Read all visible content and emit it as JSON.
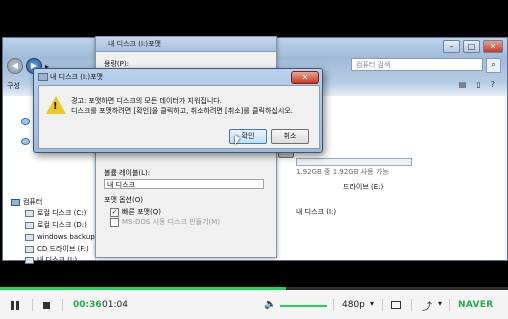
{
  "explorer": {
    "search_placeholder": "컴퓨터 검색",
    "toolbar_org": "구성",
    "nav_items": [
      {
        "label": "컴퓨터",
        "icon": "computer-icon"
      },
      {
        "label": "로컬 디스크 (C:)",
        "icon": "drive-icon"
      },
      {
        "label": "로컬 디스크 (D:)",
        "icon": "drive-icon"
      },
      {
        "label": "windows backup",
        "icon": "drive-icon"
      },
      {
        "label": "CD 드라이브 (F:)",
        "icon": "cd-drive-icon"
      },
      {
        "label": "내 디스크 (I:)",
        "icon": "drive-icon"
      },
      {
        "label": "네트워크",
        "icon": "network-icon"
      }
    ],
    "drive_e_label": "드라이브 (E:)",
    "drive_i_name": "내 디스크 (I:)",
    "drive_i_space": "1.92GB 중 1.92GB 사용 가능",
    "drive_i_used_fraction": 0.0
  },
  "format_dialog": {
    "title": "내 디스크 (I:)포맷",
    "capacity_label": "용량(P):",
    "volume_label_label": "볼륨 레이블(L):",
    "volume_label_value": "내 디스크",
    "format_options_label": "포맷 옵션(O)",
    "quick_format": "빠른 포맷(Q)",
    "msdos_boot": "MS-DOS 시동 디스크 만들기(M)"
  },
  "warning_dialog": {
    "title": "내 디스크 (I:)포맷",
    "close_glyph": "✕",
    "message_line1": "경고: 포맷하면 디스크의 모든 데이터가 지워집니다.",
    "message_line2": "디스크를 포맷하려면 [확인]을 클릭하고, 취소하려면 [취소]를 클릭하십시오.",
    "ok_label": "확인",
    "cancel_label": "취소"
  },
  "player": {
    "current_time": "00:36",
    "total_time": "01:04",
    "progress_fraction": 0.5625,
    "volume_fraction": 1.0,
    "quality": "480p",
    "brand": "NAVER",
    "brand_color": "#1fae4a",
    "accent_color": "#1fd35b"
  }
}
